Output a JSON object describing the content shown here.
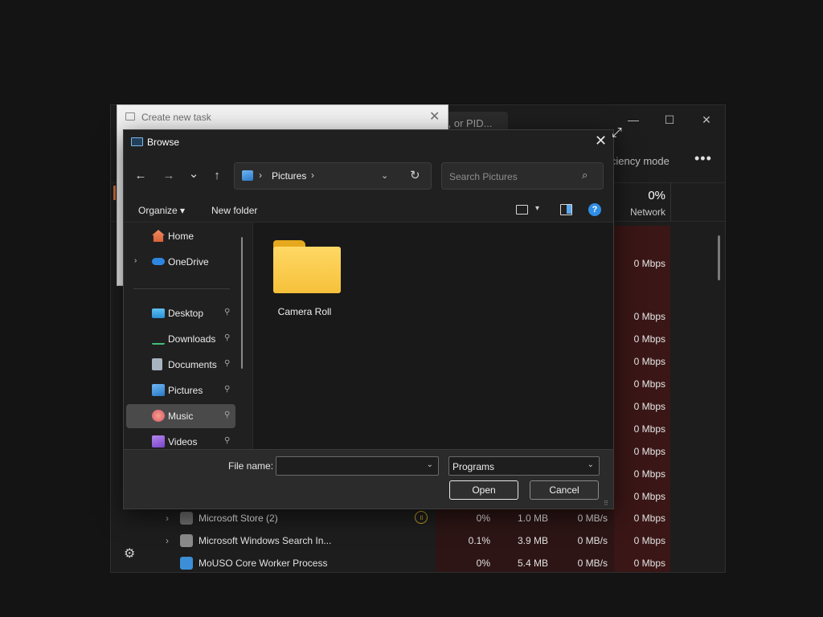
{
  "task_manager": {
    "search_text": "r, or PID...",
    "minimize": "—",
    "maximize": "☐",
    "close": "✕",
    "efficiency_mode": "fficiency mode",
    "more": "•••",
    "network_pct": "0%",
    "network_label": "Network",
    "settings_icon": "⚙",
    "net_column_values": [
      "0 Mbps",
      "0 Mbps",
      "0 Mbps",
      "0 Mbps",
      "0 Mbps",
      "0 Mbps",
      "0 Mbps",
      "0 Mbps",
      "0 Mbps",
      "0 Mbps"
    ],
    "rows": [
      {
        "expand": "›",
        "name": "Microsoft Store (2)",
        "status": "॥",
        "cpu": "0%",
        "memory": "1.0 MB",
        "disk": "0 MB/s",
        "network": "0 Mbps"
      },
      {
        "expand": "›",
        "name": "Microsoft Windows Search In...",
        "status": "",
        "cpu": "0.1%",
        "memory": "3.9 MB",
        "disk": "0 MB/s",
        "network": "0 Mbps"
      },
      {
        "expand": "",
        "name": "MoUSO Core Worker Process",
        "status": "",
        "cpu": "0%",
        "memory": "5.4 MB",
        "disk": "0 MB/s",
        "network": "0 Mbps"
      }
    ],
    "colors": {
      "network_heat": "#3a1616",
      "cpu_heat": "#2d1515"
    }
  },
  "create_task_dialog": {
    "title": "Create new task",
    "close": "✕"
  },
  "browse_dialog": {
    "title": "Browse",
    "close": "✕",
    "nav_buttons": {
      "back": "←",
      "forward": "→",
      "recent": "⌄",
      "up": "↑"
    },
    "address": {
      "separator": "›",
      "crumb": "Pictures",
      "dropdown": "⌄",
      "refresh": "↻"
    },
    "search": {
      "placeholder": "Search Pictures",
      "icon": "⌕"
    },
    "toolbar": {
      "organize": "Organize ▾",
      "new_folder": "New folder",
      "view_dropdown": "▾",
      "help": "?"
    },
    "nav_items": [
      {
        "chevron": "",
        "label": "Home",
        "icon": "home-icon",
        "pinned": false
      },
      {
        "chevron": "›",
        "label": "OneDrive",
        "icon": "onedrive-icon",
        "pinned": false
      },
      {
        "chevron": "",
        "label": "Desktop",
        "icon": "desktop-icon",
        "pinned": true
      },
      {
        "chevron": "",
        "label": "Downloads",
        "icon": "downloads-icon",
        "pinned": true
      },
      {
        "chevron": "",
        "label": "Documents",
        "icon": "documents-icon",
        "pinned": true
      },
      {
        "chevron": "",
        "label": "Pictures",
        "icon": "pictures-icon",
        "pinned": true
      },
      {
        "chevron": "",
        "label": "Music",
        "icon": "music-icon",
        "pinned": true,
        "selected": true
      },
      {
        "chevron": "",
        "label": "Videos",
        "icon": "videos-icon",
        "pinned": true
      }
    ],
    "pin_glyph": "📌",
    "files": [
      {
        "name": "Camera Roll",
        "type": "folder"
      }
    ],
    "file_name_label": "File name:",
    "file_name_value": "",
    "file_type": "Programs",
    "dropdown_glyph": "⌄",
    "open_button": "Open",
    "cancel_button": "Cancel",
    "colors": {
      "accent": "#2f8ee5",
      "folder": "#f6c13a",
      "selected_item": "#4a4a4a"
    }
  },
  "resize_cursor": "⤢"
}
